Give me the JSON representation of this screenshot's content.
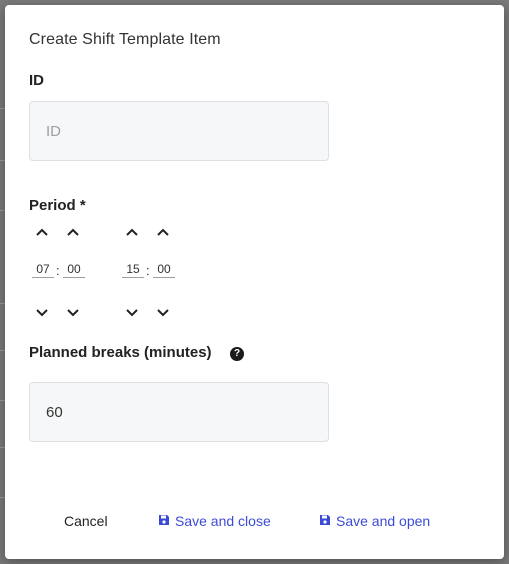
{
  "dialog": {
    "title": "Create Shift Template Item"
  },
  "id_field": {
    "label": "ID",
    "placeholder": "ID",
    "value": ""
  },
  "period": {
    "label": "Period *",
    "start": {
      "hours": "07",
      "minutes": "00"
    },
    "end": {
      "hours": "15",
      "minutes": "00"
    },
    "separator": ":"
  },
  "breaks": {
    "label": "Planned breaks (minutes)",
    "help_icon": "help-circle-icon",
    "value": "60"
  },
  "actions": {
    "cancel": "Cancel",
    "save_close": "Save and close",
    "save_open": "Save and open",
    "save_icon": "floppy-disk-icon"
  },
  "colors": {
    "accent": "#3c4bd6",
    "overlay": "#7a7a7a",
    "input_bg": "#f6f7f9"
  }
}
